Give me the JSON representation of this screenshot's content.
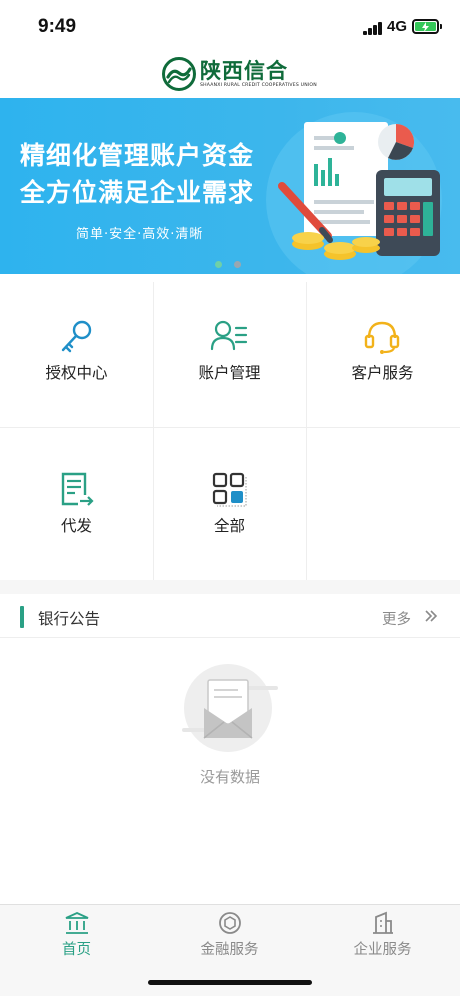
{
  "status": {
    "time": "9:49",
    "network": "4G"
  },
  "header": {
    "logo_cn": "陕西信合",
    "logo_en": "SHAANXI RURAL CREDIT COOPERATIVES UNION"
  },
  "banner": {
    "line1": "精细化管理账户资金",
    "line2": "全方位满足企业需求",
    "subtitle": "简单·安全·高效·清晰",
    "active_dot": 1,
    "dot_count": 2
  },
  "menu": [
    {
      "label": "授权中心",
      "icon": "key-icon"
    },
    {
      "label": "账户管理",
      "icon": "account-list-icon"
    },
    {
      "label": "客户服务",
      "icon": "headset-icon"
    },
    {
      "label": "代发",
      "icon": "payroll-document-icon"
    },
    {
      "label": "全部",
      "icon": "all-grid-icon"
    }
  ],
  "notice": {
    "title": "银行公告",
    "more": "更多",
    "more_icon": "double-chevron-right-icon"
  },
  "empty": {
    "text": "没有数据",
    "icon": "empty-mail-icon"
  },
  "tabbar": [
    {
      "label": "首页",
      "icon": "bank-icon",
      "active": true
    },
    {
      "label": "金融服务",
      "icon": "finance-coin-icon",
      "active": false
    },
    {
      "label": "企业服务",
      "icon": "building-icon",
      "active": false
    }
  ],
  "colors": {
    "brand_green": "#0f6b3a",
    "accent_teal": "#2aa085",
    "icon_blue": "#1f8fc8",
    "icon_yellow": "#f2b21a",
    "banner_blue": "#35b4ed",
    "inactive": "#8a8a8a"
  }
}
